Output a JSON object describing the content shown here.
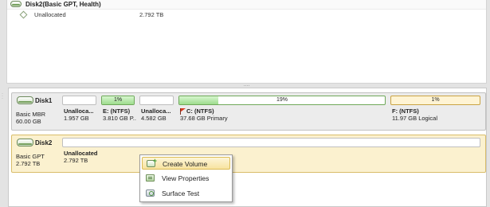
{
  "top_list": {
    "header_disk": "Disk2(Basic GPT, Health)",
    "rows": [
      {
        "name": "Unallocated",
        "capacity": "2.792 TB"
      }
    ]
  },
  "splitter_glyph": "....",
  "disks": [
    {
      "name": "Disk1",
      "type": "Basic MBR",
      "size": "60.00 GB",
      "partitions": [
        {
          "label": "Unalloca...",
          "detail": "1.957 GB",
          "used_pct_text": ""
        },
        {
          "label": "E: (NTFS)",
          "detail": "3.810 GB P...",
          "used_pct_text": "1%",
          "used_fraction": 0.01
        },
        {
          "label": "Unalloca...",
          "detail": "4.582 GB",
          "used_pct_text": ""
        },
        {
          "label": "C: (NTFS)",
          "detail": "37.68 GB Primary",
          "used_pct_text": "19%",
          "used_fraction": 0.19
        },
        {
          "label": "F: (NTFS)",
          "detail": "11.97 GB Logical",
          "used_pct_text": "1%",
          "used_fraction": 0.01
        }
      ]
    },
    {
      "name": "Disk2",
      "type": "Basic GPT",
      "size": "2.792 TB",
      "partitions": [
        {
          "label": "Unallocated",
          "detail": "2.792 TB",
          "used_pct_text": ""
        }
      ]
    }
  ],
  "context_menu": {
    "items": [
      {
        "label": "Create Volume",
        "icon": "create-volume-icon",
        "highlighted": true
      },
      {
        "label": "View Properties",
        "icon": "properties-icon",
        "highlighted": false
      },
      {
        "label": "Surface Test",
        "icon": "surface-test-icon",
        "highlighted": false
      }
    ]
  },
  "colors": {
    "selected_disk_bg": "#fbf1cf",
    "used_fill": "#9edc8d",
    "logical_bar": "#fff4d4",
    "menu_highlight": "#f7e3a0"
  }
}
